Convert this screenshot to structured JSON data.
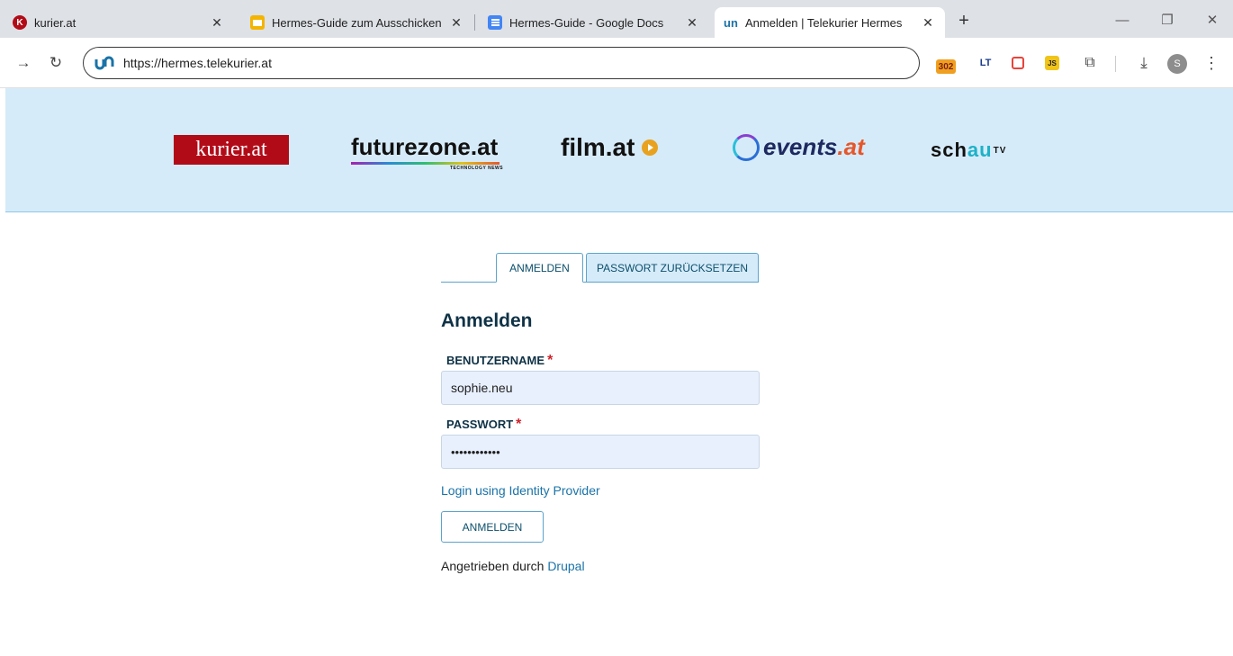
{
  "browser": {
    "tabs": [
      {
        "title": "kurier.at",
        "favicon": "K",
        "favicon_color": "#b20b18"
      },
      {
        "title": "Hermes-Guide zum Ausschicken",
        "favicon": "",
        "favicon_color": "#f4b400"
      },
      {
        "title": "Hermes-Guide - Google Docs",
        "favicon": "",
        "favicon_color": "#4285f4"
      },
      {
        "title": "Anmelden | Telekurier Hermes",
        "favicon": "un",
        "favicon_color": "#1a73a8"
      }
    ],
    "close_glyph": "✕",
    "new_tab_glyph": "+",
    "url": "https://hermes.telekurier.at",
    "extension_badge": "302",
    "profile_initial": "S"
  },
  "banner": {
    "kurier": "kurier.at",
    "futurezone": "futurezone.at",
    "futurezone_sub": "TECHNOLOGY NEWS",
    "film": "film.at",
    "events_name": "events",
    "events_dot": ".at",
    "schau_1": "sch",
    "schau_2": "au",
    "schau_sup": "TV"
  },
  "login": {
    "tab_login": "ANMELDEN",
    "tab_reset": "PASSWORT ZURÜCKSETZEN",
    "heading": "Anmelden",
    "username_label": "BENUTZERNAME",
    "username_value": "sophie.neu",
    "password_label": "PASSWORT",
    "password_value": "••••••••••••",
    "required_mark": "*",
    "idp_link": "Login using Identity Provider",
    "submit_label": "ANMELDEN",
    "powered_prefix": "Angetrieben durch ",
    "powered_link": "Drupal"
  },
  "colors": {
    "banner_bg": "#d6ebf9",
    "accent": "#5ca3cc",
    "link": "#1a73a8",
    "kurier_red": "#b20b18"
  }
}
